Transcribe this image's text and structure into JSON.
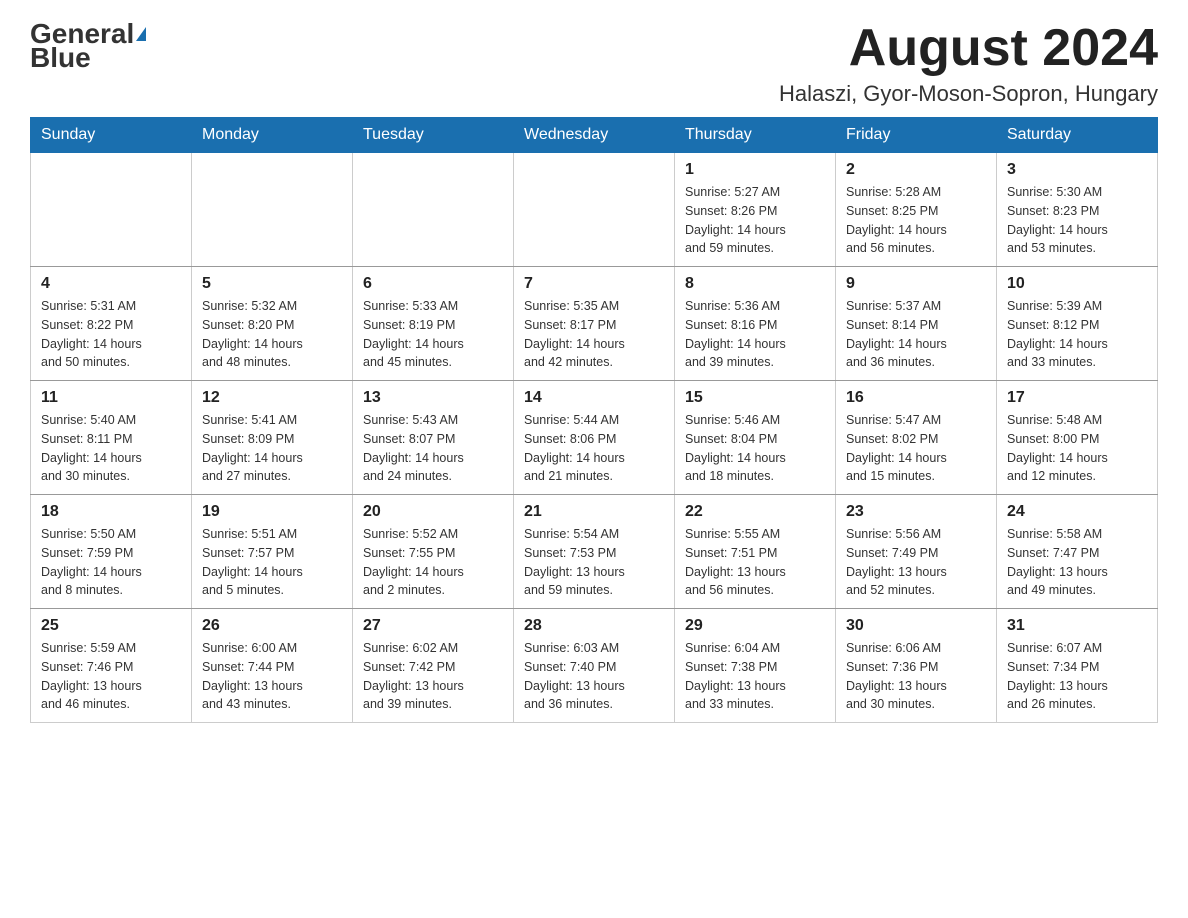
{
  "header": {
    "logo_text_part1": "General",
    "logo_text_part2": "Blue",
    "month_title": "August 2024",
    "location": "Halaszi, Gyor-Moson-Sopron, Hungary"
  },
  "weekdays": [
    "Sunday",
    "Monday",
    "Tuesday",
    "Wednesday",
    "Thursday",
    "Friday",
    "Saturday"
  ],
  "weeks": [
    [
      {
        "day": "",
        "info": ""
      },
      {
        "day": "",
        "info": ""
      },
      {
        "day": "",
        "info": ""
      },
      {
        "day": "",
        "info": ""
      },
      {
        "day": "1",
        "info": "Sunrise: 5:27 AM\nSunset: 8:26 PM\nDaylight: 14 hours\nand 59 minutes."
      },
      {
        "day": "2",
        "info": "Sunrise: 5:28 AM\nSunset: 8:25 PM\nDaylight: 14 hours\nand 56 minutes."
      },
      {
        "day": "3",
        "info": "Sunrise: 5:30 AM\nSunset: 8:23 PM\nDaylight: 14 hours\nand 53 minutes."
      }
    ],
    [
      {
        "day": "4",
        "info": "Sunrise: 5:31 AM\nSunset: 8:22 PM\nDaylight: 14 hours\nand 50 minutes."
      },
      {
        "day": "5",
        "info": "Sunrise: 5:32 AM\nSunset: 8:20 PM\nDaylight: 14 hours\nand 48 minutes."
      },
      {
        "day": "6",
        "info": "Sunrise: 5:33 AM\nSunset: 8:19 PM\nDaylight: 14 hours\nand 45 minutes."
      },
      {
        "day": "7",
        "info": "Sunrise: 5:35 AM\nSunset: 8:17 PM\nDaylight: 14 hours\nand 42 minutes."
      },
      {
        "day": "8",
        "info": "Sunrise: 5:36 AM\nSunset: 8:16 PM\nDaylight: 14 hours\nand 39 minutes."
      },
      {
        "day": "9",
        "info": "Sunrise: 5:37 AM\nSunset: 8:14 PM\nDaylight: 14 hours\nand 36 minutes."
      },
      {
        "day": "10",
        "info": "Sunrise: 5:39 AM\nSunset: 8:12 PM\nDaylight: 14 hours\nand 33 minutes."
      }
    ],
    [
      {
        "day": "11",
        "info": "Sunrise: 5:40 AM\nSunset: 8:11 PM\nDaylight: 14 hours\nand 30 minutes."
      },
      {
        "day": "12",
        "info": "Sunrise: 5:41 AM\nSunset: 8:09 PM\nDaylight: 14 hours\nand 27 minutes."
      },
      {
        "day": "13",
        "info": "Sunrise: 5:43 AM\nSunset: 8:07 PM\nDaylight: 14 hours\nand 24 minutes."
      },
      {
        "day": "14",
        "info": "Sunrise: 5:44 AM\nSunset: 8:06 PM\nDaylight: 14 hours\nand 21 minutes."
      },
      {
        "day": "15",
        "info": "Sunrise: 5:46 AM\nSunset: 8:04 PM\nDaylight: 14 hours\nand 18 minutes."
      },
      {
        "day": "16",
        "info": "Sunrise: 5:47 AM\nSunset: 8:02 PM\nDaylight: 14 hours\nand 15 minutes."
      },
      {
        "day": "17",
        "info": "Sunrise: 5:48 AM\nSunset: 8:00 PM\nDaylight: 14 hours\nand 12 minutes."
      }
    ],
    [
      {
        "day": "18",
        "info": "Sunrise: 5:50 AM\nSunset: 7:59 PM\nDaylight: 14 hours\nand 8 minutes."
      },
      {
        "day": "19",
        "info": "Sunrise: 5:51 AM\nSunset: 7:57 PM\nDaylight: 14 hours\nand 5 minutes."
      },
      {
        "day": "20",
        "info": "Sunrise: 5:52 AM\nSunset: 7:55 PM\nDaylight: 14 hours\nand 2 minutes."
      },
      {
        "day": "21",
        "info": "Sunrise: 5:54 AM\nSunset: 7:53 PM\nDaylight: 13 hours\nand 59 minutes."
      },
      {
        "day": "22",
        "info": "Sunrise: 5:55 AM\nSunset: 7:51 PM\nDaylight: 13 hours\nand 56 minutes."
      },
      {
        "day": "23",
        "info": "Sunrise: 5:56 AM\nSunset: 7:49 PM\nDaylight: 13 hours\nand 52 minutes."
      },
      {
        "day": "24",
        "info": "Sunrise: 5:58 AM\nSunset: 7:47 PM\nDaylight: 13 hours\nand 49 minutes."
      }
    ],
    [
      {
        "day": "25",
        "info": "Sunrise: 5:59 AM\nSunset: 7:46 PM\nDaylight: 13 hours\nand 46 minutes."
      },
      {
        "day": "26",
        "info": "Sunrise: 6:00 AM\nSunset: 7:44 PM\nDaylight: 13 hours\nand 43 minutes."
      },
      {
        "day": "27",
        "info": "Sunrise: 6:02 AM\nSunset: 7:42 PM\nDaylight: 13 hours\nand 39 minutes."
      },
      {
        "day": "28",
        "info": "Sunrise: 6:03 AM\nSunset: 7:40 PM\nDaylight: 13 hours\nand 36 minutes."
      },
      {
        "day": "29",
        "info": "Sunrise: 6:04 AM\nSunset: 7:38 PM\nDaylight: 13 hours\nand 33 minutes."
      },
      {
        "day": "30",
        "info": "Sunrise: 6:06 AM\nSunset: 7:36 PM\nDaylight: 13 hours\nand 30 minutes."
      },
      {
        "day": "31",
        "info": "Sunrise: 6:07 AM\nSunset: 7:34 PM\nDaylight: 13 hours\nand 26 minutes."
      }
    ]
  ]
}
